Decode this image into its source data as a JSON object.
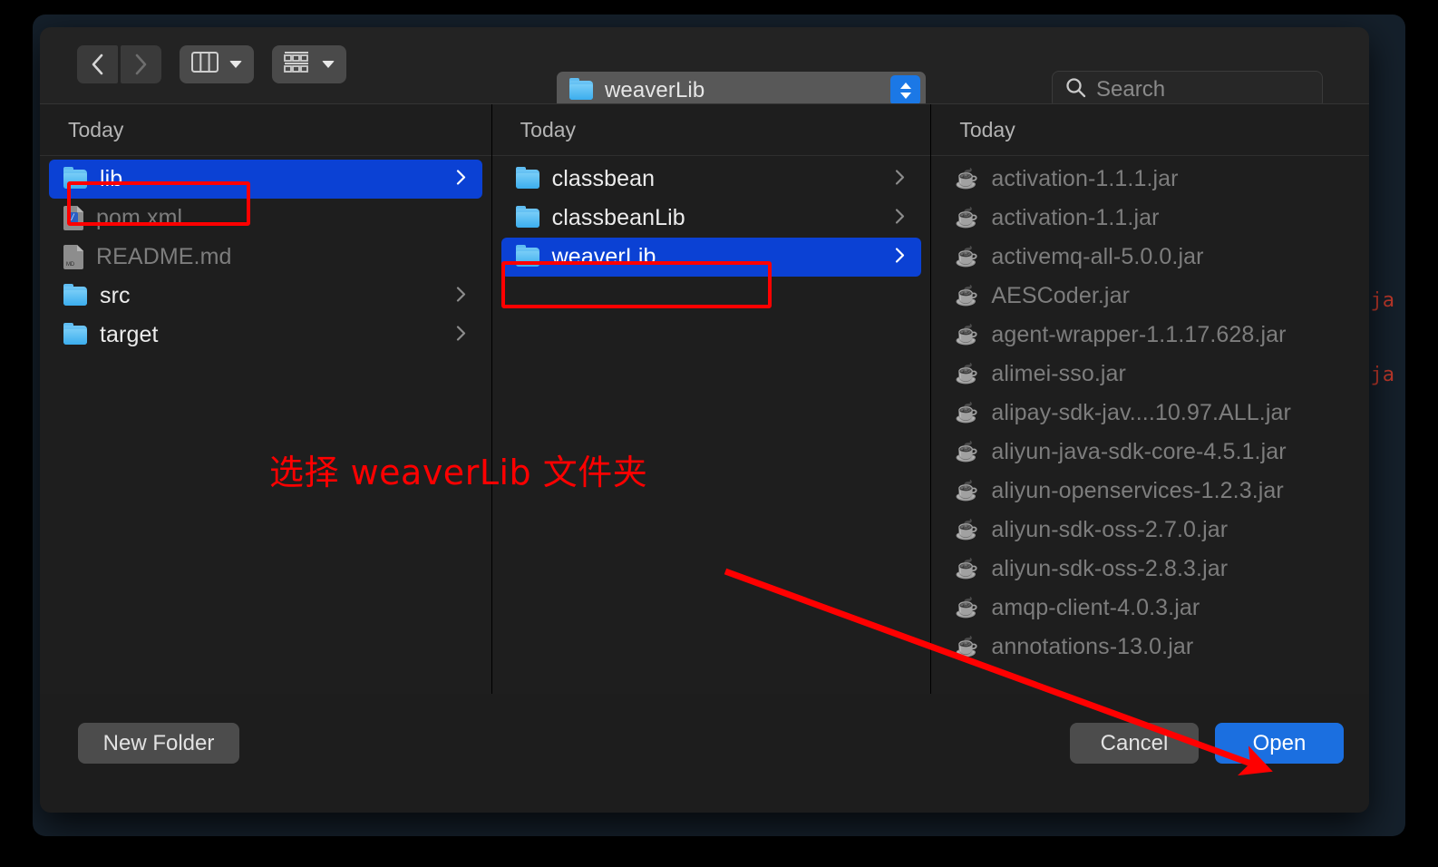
{
  "background_window": {
    "code_fragments": [
      "s.ja",
      "c.ja"
    ]
  },
  "dialog": {
    "toolbar": {
      "back_button": "back-icon",
      "forward_button": "forward-icon",
      "view_button": {
        "icon": "column-view-icon",
        "chevron": "chevron-down-icon"
      },
      "arrange_button": {
        "icon": "group-items-icon",
        "chevron": "chevron-down-icon"
      },
      "path_popup": {
        "label": "weaverLib",
        "icon": "folder-icon",
        "stepper": "up-down-stepper-icon"
      },
      "search": {
        "placeholder": "Search",
        "icon": "search-icon",
        "value": ""
      }
    },
    "columns": [
      {
        "header": "Today",
        "items": [
          {
            "name": "lib",
            "icon": "folder-icon",
            "selected": true,
            "dim": false,
            "chevron": true
          },
          {
            "name": "pom.xml",
            "icon": "xml-file-icon",
            "selected": false,
            "dim": true,
            "chevron": false
          },
          {
            "name": "README.md",
            "icon": "md-file-icon",
            "selected": false,
            "dim": true,
            "chevron": false
          },
          {
            "name": "src",
            "icon": "folder-icon",
            "selected": false,
            "dim": false,
            "chevron": true
          },
          {
            "name": "target",
            "icon": "folder-icon",
            "selected": false,
            "dim": false,
            "chevron": true
          }
        ]
      },
      {
        "header": "Today",
        "items": [
          {
            "name": "classbean",
            "icon": "folder-icon",
            "selected": false,
            "dim": false,
            "chevron": true
          },
          {
            "name": "classbeanLib",
            "icon": "folder-icon",
            "selected": false,
            "dim": false,
            "chevron": true
          },
          {
            "name": "weaverLib",
            "icon": "folder-icon",
            "selected": true,
            "dim": false,
            "chevron": true
          }
        ]
      },
      {
        "header": "Today",
        "items": [
          {
            "name": "activation-1.1.1.jar",
            "icon": "jar-file-icon",
            "selected": false,
            "dim": true,
            "chevron": false
          },
          {
            "name": "activation-1.1.jar",
            "icon": "jar-file-icon",
            "selected": false,
            "dim": true,
            "chevron": false
          },
          {
            "name": "activemq-all-5.0.0.jar",
            "icon": "jar-file-icon",
            "selected": false,
            "dim": true,
            "chevron": false
          },
          {
            "name": "AESCoder.jar",
            "icon": "jar-file-icon",
            "selected": false,
            "dim": true,
            "chevron": false
          },
          {
            "name": "agent-wrapper-1.1.17.628.jar",
            "icon": "jar-file-icon",
            "selected": false,
            "dim": true,
            "chevron": false
          },
          {
            "name": "alimei-sso.jar",
            "icon": "jar-file-icon",
            "selected": false,
            "dim": true,
            "chevron": false
          },
          {
            "name": "alipay-sdk-jav....10.97.ALL.jar",
            "icon": "jar-file-icon",
            "selected": false,
            "dim": true,
            "chevron": false
          },
          {
            "name": "aliyun-java-sdk-core-4.5.1.jar",
            "icon": "jar-file-icon",
            "selected": false,
            "dim": true,
            "chevron": false
          },
          {
            "name": "aliyun-openservices-1.2.3.jar",
            "icon": "jar-file-icon",
            "selected": false,
            "dim": true,
            "chevron": false
          },
          {
            "name": "aliyun-sdk-oss-2.7.0.jar",
            "icon": "jar-file-icon",
            "selected": false,
            "dim": true,
            "chevron": false
          },
          {
            "name": "aliyun-sdk-oss-2.8.3.jar",
            "icon": "jar-file-icon",
            "selected": false,
            "dim": true,
            "chevron": false
          },
          {
            "name": "amqp-client-4.0.3.jar",
            "icon": "jar-file-icon",
            "selected": false,
            "dim": true,
            "chevron": false
          },
          {
            "name": "annotations-13.0.jar",
            "icon": "jar-file-icon",
            "selected": false,
            "dim": true,
            "chevron": false
          }
        ]
      }
    ],
    "footer": {
      "new_folder_label": "New Folder",
      "cancel_label": "Cancel",
      "open_label": "Open"
    }
  },
  "annotations": {
    "instruction_text": "选择 weaverLib 文件夹",
    "color": "#ff0000",
    "highlight_boxes": [
      "lib",
      "weaverLib"
    ],
    "arrow": "points-to-open-button"
  }
}
